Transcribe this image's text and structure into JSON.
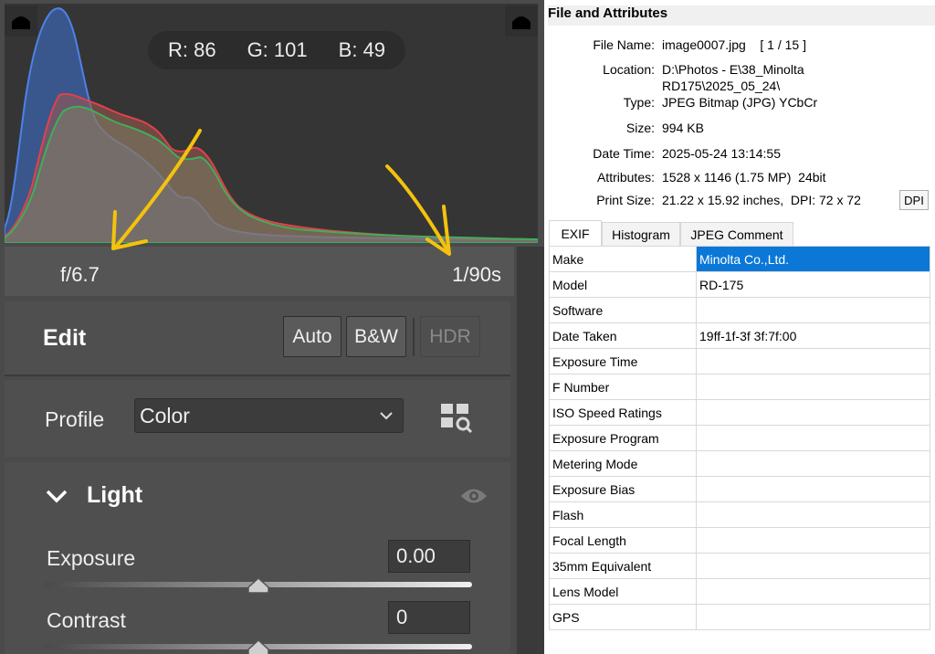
{
  "histogram": {
    "readout": {
      "r_label": "R:",
      "r_value": "86",
      "g_label": "G:",
      "g_value": "101",
      "b_label": "B:",
      "b_value": "49"
    },
    "colors": {
      "red": "#e0424a",
      "green": "#3fae5c",
      "blue": "#3d72d4",
      "background": "#353535"
    }
  },
  "exposure_info": {
    "aperture": "f/6.7",
    "shutter": "1/90s"
  },
  "edit": {
    "title": "Edit",
    "auto_label": "Auto",
    "bw_label": "B&W",
    "hdr_label": "HDR"
  },
  "profile": {
    "label": "Profile",
    "value": "Color"
  },
  "light": {
    "title": "Light",
    "sliders": [
      {
        "label": "Exposure",
        "value": "0.00",
        "position": 0.5
      },
      {
        "label": "Contrast",
        "value": "0",
        "position": 0.5
      }
    ]
  },
  "annotation": {
    "arrow_color": "#f4c20d"
  },
  "file_info": {
    "title": "File and Attributes",
    "fields": [
      {
        "label": "File Name:",
        "value": "image0007.jpg    [ 1 / 15 ]"
      },
      {
        "label": "Location:",
        "value": "D:\\Photos - E\\38_Minolta",
        "value2": "RD175\\2025_05_24\\"
      },
      {
        "label": "Type:",
        "value": "JPEG Bitmap (JPG) YCbCr"
      },
      {
        "label": "Size:",
        "value": "994 KB"
      },
      {
        "label": "Date Time:",
        "value": "2025-05-24 13:14:55"
      },
      {
        "label": "Attributes:",
        "value": "1528 x 1146 (1.75 MP)  24bit"
      },
      {
        "label": "Print Size:",
        "value": "21.22 x 15.92 inches,  DPI: 72 x 72"
      }
    ],
    "dpi_button": "DPI",
    "tabs": [
      "EXIF",
      "Histogram",
      "JPEG Comment"
    ],
    "active_tab": "EXIF",
    "exif_rows": [
      {
        "tag": "Make",
        "value": "Minolta Co.,Ltd."
      },
      {
        "tag": "Model",
        "value": "RD-175"
      },
      {
        "tag": "Software",
        "value": ""
      },
      {
        "tag": "Date Taken",
        "value": "19ff-1f-3f 3f:7f:00"
      },
      {
        "tag": "Exposure Time",
        "value": ""
      },
      {
        "tag": "F Number",
        "value": ""
      },
      {
        "tag": "ISO Speed Ratings",
        "value": ""
      },
      {
        "tag": "Exposure Program",
        "value": ""
      },
      {
        "tag": "Metering Mode",
        "value": ""
      },
      {
        "tag": "Exposure Bias",
        "value": ""
      },
      {
        "tag": "Flash",
        "value": ""
      },
      {
        "tag": "Focal Length",
        "value": ""
      },
      {
        "tag": "35mm Equivalent",
        "value": ""
      },
      {
        "tag": "Lens Model",
        "value": ""
      },
      {
        "tag": "GPS",
        "value": ""
      }
    ]
  }
}
